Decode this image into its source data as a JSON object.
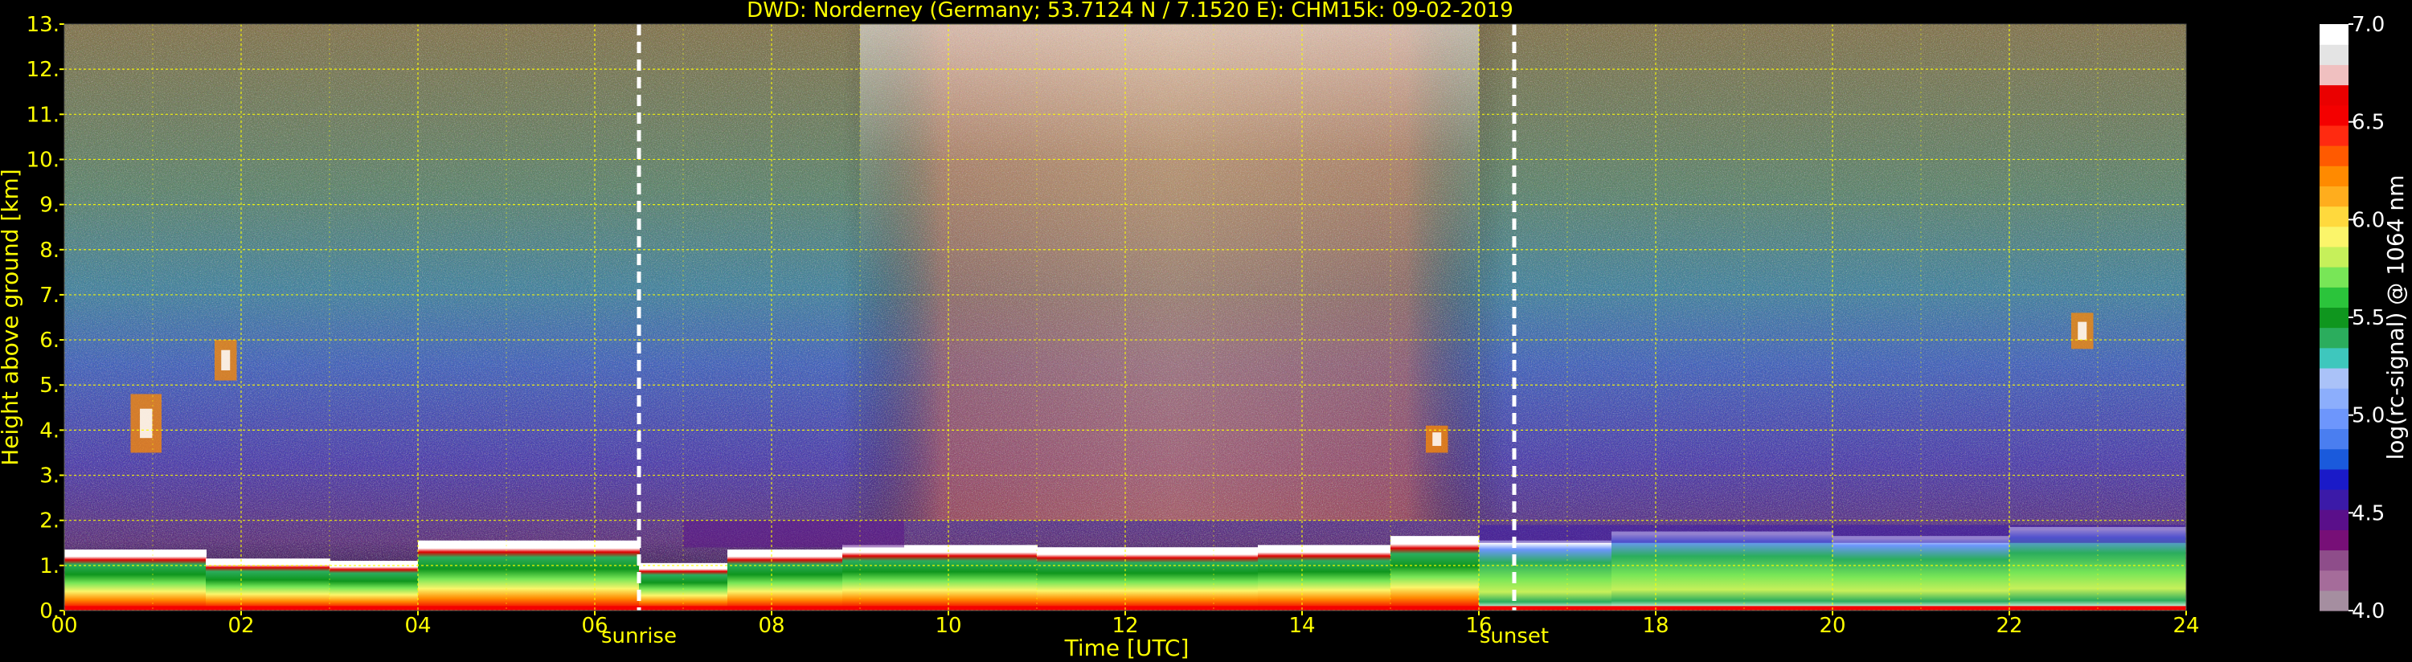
{
  "chart_data": {
    "type": "heatmap",
    "title": "DWD: Norderney (Germany; 53.7124 N / 7.1520 E):    CHM15k: 09-02-2019",
    "xlabel": "Time [UTC]",
    "ylabel": "Height above ground [km]",
    "xlim": [
      0,
      24
    ],
    "ylim": [
      0,
      13
    ],
    "x_ticks": [
      "00",
      "02",
      "04",
      "06",
      "08",
      "10",
      "12",
      "14",
      "16",
      "18",
      "20",
      "22",
      "24"
    ],
    "y_ticks": [
      "0.",
      "1.",
      "2.",
      "3.",
      "4.",
      "5.",
      "6.",
      "7.",
      "8.",
      "9.",
      "10.",
      "11.",
      "12.",
      "13."
    ],
    "grid": true,
    "background": "#000000",
    "text_color": "#ffff00",
    "colorbar": {
      "label": "log(rc-signal) @ 1064 nm",
      "range": [
        4.0,
        7.0
      ],
      "ticks": [
        "4.0",
        "4.5",
        "5.0",
        "5.5",
        "6.0",
        "6.5",
        "7.0"
      ],
      "colors": [
        "#a58ea0",
        "#a56c9a",
        "#8e4d8a",
        "#770f77",
        "#5a0f8a",
        "#3b1aa8",
        "#1a1ac8",
        "#1a5adc",
        "#4a7ef0",
        "#6d96fc",
        "#8caefc",
        "#aac2f8",
        "#3ec7bd",
        "#2bad5d",
        "#0f961e",
        "#2bc43b",
        "#78e657",
        "#c6f05a",
        "#fbf56a",
        "#ffd93d",
        "#ffad1d",
        "#ff8a00",
        "#ff5a00",
        "#ff2a10",
        "#f40000",
        "#ea0000",
        "#f0c0c0",
        "#e4e4e4",
        "#ffffff"
      ]
    },
    "annotations": [
      {
        "label": "sunrise",
        "x": 6.5
      },
      {
        "label": "sunset",
        "x": 16.4
      }
    ],
    "layers": [
      {
        "start": 0.0,
        "end": 1.6,
        "top": 1.3
      },
      {
        "start": 1.6,
        "end": 3.0,
        "top": 1.1
      },
      {
        "start": 3.0,
        "end": 4.0,
        "top": 1.05
      },
      {
        "start": 4.0,
        "end": 6.5,
        "top": 1.5
      },
      {
        "start": 6.5,
        "end": 7.5,
        "top": 1.0
      },
      {
        "start": 7.5,
        "end": 8.8,
        "top": 1.3
      },
      {
        "start": 8.8,
        "end": 11.0,
        "top": 1.4
      },
      {
        "start": 11.0,
        "end": 13.5,
        "top": 1.35
      },
      {
        "start": 13.5,
        "end": 15.0,
        "top": 1.4
      },
      {
        "start": 15.0,
        "end": 16.0,
        "top": 1.6
      },
      {
        "start": 16.0,
        "end": 17.5,
        "top": 1.5
      },
      {
        "start": 17.5,
        "end": 20.0,
        "top": 1.7
      },
      {
        "start": 20.0,
        "end": 22.0,
        "top": 1.6
      },
      {
        "start": 22.0,
        "end": 24.0,
        "top": 1.8
      }
    ],
    "cloud_patches": [
      {
        "t0": 0.75,
        "t1": 1.1,
        "h0": 3.5,
        "h1": 4.8
      },
      {
        "t0": 1.7,
        "t1": 1.95,
        "h0": 5.1,
        "h1": 6.0
      },
      {
        "t0": 22.7,
        "t1": 22.95,
        "h0": 5.8,
        "h1": 6.6
      },
      {
        "t0": 15.4,
        "t1": 15.65,
        "h0": 3.5,
        "h1": 4.1
      }
    ]
  }
}
